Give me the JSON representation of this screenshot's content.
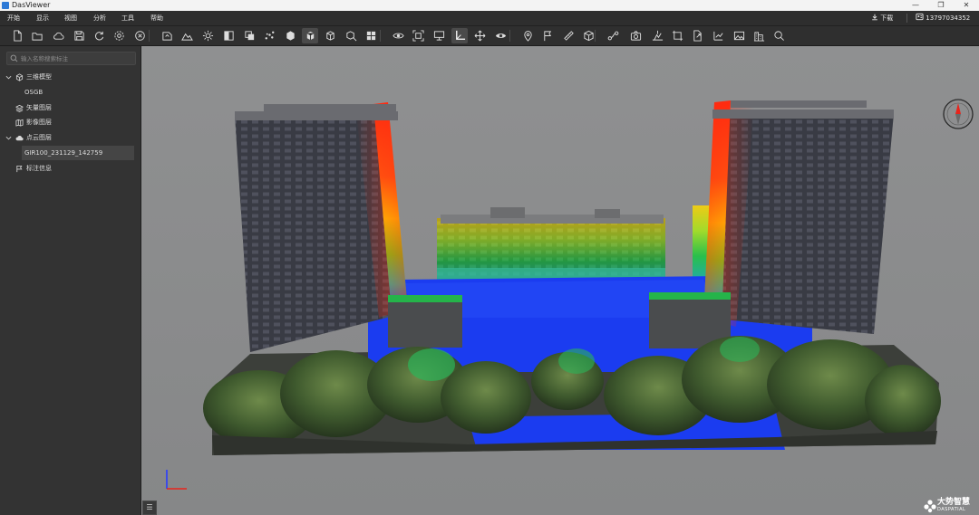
{
  "app": {
    "title": "DasViewer",
    "minimize": "—",
    "restore": "❐",
    "close": "✕"
  },
  "menu": {
    "items": [
      "开始",
      "显示",
      "视图",
      "分析",
      "工具",
      "帮助"
    ],
    "download_label": "下载",
    "user_id": "13797034352"
  },
  "toolbar": {
    "icons": [
      "new-file-icon",
      "open-folder-icon",
      "cloud-icon",
      "save-icon",
      "refresh-icon",
      "settings-icon",
      "close-circle-icon",
      "import-model-icon",
      "terrain-icon",
      "light-icon",
      "color-mode-icon",
      "layer-icon",
      "point-cloud-icon",
      "cube-icon",
      "box-icon",
      "wireframe-box-icon",
      "measure-box-icon",
      "grid-icon",
      "view-icon",
      "fit-view-icon",
      "monitor-icon",
      "axis-icon",
      "pan-icon",
      "eye-icon",
      "location-pin-icon",
      "flag-icon",
      "ruler-icon",
      "volume-icon",
      "path-icon",
      "camera-icon",
      "elevation-icon",
      "crop-icon",
      "export-icon",
      "chart-export-icon",
      "image-icon",
      "building-icon",
      "search-icon"
    ]
  },
  "sidebar": {
    "search_placeholder": "输入名称搜索标注",
    "tree": [
      {
        "label": "三维模型",
        "icon": "cube-icon",
        "expanded": true
      },
      {
        "label": "OSGB",
        "child": true
      },
      {
        "label": "矢量图层",
        "icon": "vector-layer-icon"
      },
      {
        "label": "影像图层",
        "icon": "map-layer-icon"
      },
      {
        "label": "点云图层",
        "icon": "cloud-layer-icon",
        "expanded": true
      },
      {
        "label": "GIR100_231129_142759",
        "child": true,
        "selected": true
      },
      {
        "label": "标注信息",
        "icon": "annotation-icon"
      }
    ],
    "bottom_button": "☰"
  },
  "brand": {
    "name": "大势智慧",
    "sub": "DASPATIAL"
  },
  "colors": {
    "viewport_bg": "#8a8b8c",
    "panel_bg": "#333333",
    "toolbar_bg": "#2f2f2f",
    "accent_red": "#e8241c"
  }
}
